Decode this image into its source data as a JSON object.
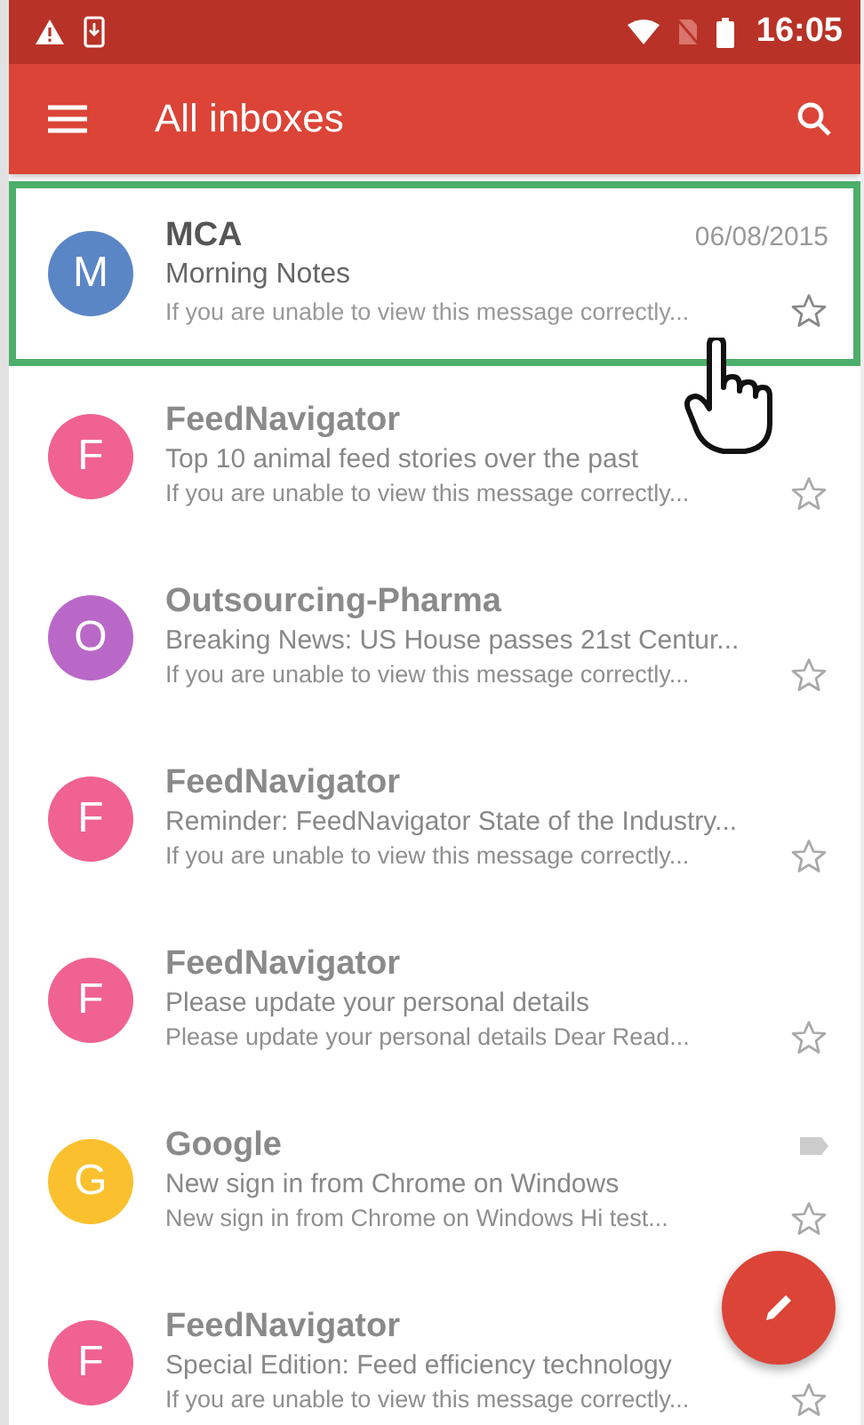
{
  "status_bar": {
    "time": "16:05"
  },
  "app_bar": {
    "title": "All inboxes"
  },
  "messages": [
    {
      "initial": "M",
      "color": "#5b86c6",
      "sender": "MCA",
      "date": "06/08/2015",
      "subject": "Morning Notes",
      "snippet": "If you are unable to view this message correctly...",
      "selected": true,
      "blurred": false,
      "has_label": false
    },
    {
      "initial": "F",
      "color": "#f06292",
      "sender": "FeedNavigator",
      "subject": "Top 10 animal feed stories over the past",
      "snippet": "If you are unable to view this message correctly...",
      "selected": false,
      "blurred": true,
      "has_label": false
    },
    {
      "initial": "O",
      "color": "#ba68c8",
      "sender": "Outsourcing-Pharma",
      "subject": "Breaking News: US House passes 21st Centur...",
      "snippet": "If you are unable to view this message correctly...",
      "selected": false,
      "blurred": true,
      "has_label": false
    },
    {
      "initial": "F",
      "color": "#f06292",
      "sender": "FeedNavigator",
      "subject": "Reminder: FeedNavigator State of the Industry...",
      "snippet": "If you are unable to view this message correctly...",
      "selected": false,
      "blurred": true,
      "has_label": false
    },
    {
      "initial": "F",
      "color": "#f06292",
      "sender": "FeedNavigator",
      "subject": "Please update your personal details",
      "snippet": "Please update your personal details Dear Read...",
      "selected": false,
      "blurred": true,
      "has_label": false
    },
    {
      "initial": "G",
      "color": "#fbc02d",
      "sender": "Google",
      "subject": "New sign in from Chrome on Windows",
      "snippet": "New sign in from Chrome on Windows Hi test...",
      "selected": false,
      "blurred": true,
      "has_label": true
    },
    {
      "initial": "F",
      "color": "#f06292",
      "sender": "FeedNavigator",
      "subject": "Special Edition: Feed efficiency technology",
      "snippet": "If you are unable to view this message correctly...",
      "selected": false,
      "blurred": true,
      "has_label": false
    }
  ]
}
